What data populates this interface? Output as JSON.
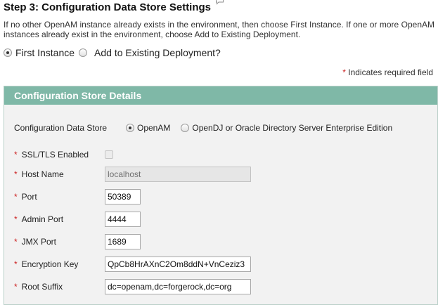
{
  "header": {
    "title": "Step 3: Configuration Data Store Settings",
    "help_icon": "speech-bubble-icon"
  },
  "intro_text": "If no other OpenAM instance already exists in the environment, then choose First Instance. If one or more OpenAM instances already exist in the environment, choose Add to Existing Deployment.",
  "deployment_mode": {
    "options": [
      {
        "label": "First Instance",
        "selected": true
      },
      {
        "label": "Add to Existing Deployment?",
        "selected": false
      }
    ]
  },
  "required_note": {
    "marker": "*",
    "text": "Indicates required field"
  },
  "panel": {
    "title": "Configuration Store Details",
    "header_color": "#7fb8a7",
    "store_type": {
      "label": "Configuration Data Store",
      "options": [
        {
          "label": "OpenAM",
          "selected": true
        },
        {
          "label": "OpenDJ or Oracle Directory Server Enterprise Edition",
          "selected": false
        }
      ]
    },
    "fields": {
      "ssl": {
        "label": "SSL/TLS Enabled",
        "checked": false,
        "disabled": true
      },
      "host": {
        "label": "Host Name",
        "value": "localhost",
        "disabled": true
      },
      "port": {
        "label": "Port",
        "value": "50389"
      },
      "admin_port": {
        "label": "Admin Port",
        "value": "4444"
      },
      "jmx_port": {
        "label": "JMX Port",
        "value": "1689"
      },
      "encryption_key": {
        "label": "Encryption Key",
        "value": "QpCb8HrAXnC2Om8ddN+VnCeziz3"
      },
      "root_suffix": {
        "label": "Root Suffix",
        "value": "dc=openam,dc=forgerock,dc=org"
      }
    }
  }
}
